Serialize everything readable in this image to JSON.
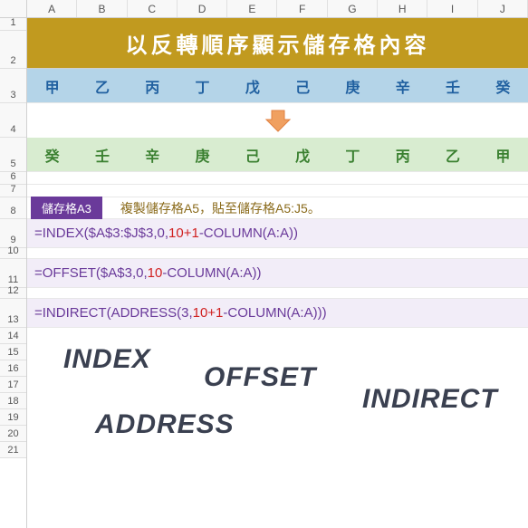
{
  "columns": [
    "A",
    "B",
    "C",
    "D",
    "E",
    "F",
    "G",
    "H",
    "I",
    "J"
  ],
  "rows": [
    "1",
    "2",
    "3",
    "4",
    "5",
    "6",
    "7",
    "8",
    "9",
    "10",
    "11",
    "12",
    "13",
    "14",
    "15",
    "16",
    "17",
    "18",
    "19",
    "20",
    "21"
  ],
  "title": "以反轉順序顯示儲存格內容",
  "rowBlue": [
    "甲",
    "乙",
    "丙",
    "丁",
    "戊",
    "己",
    "庚",
    "辛",
    "壬",
    "癸"
  ],
  "rowGreen": [
    "癸",
    "壬",
    "辛",
    "庚",
    "己",
    "戊",
    "丁",
    "丙",
    "乙",
    "甲"
  ],
  "cellLabel": "儲存格A3",
  "copyNote": "複製儲存格A5，貼至儲存格A5:J5。",
  "formula1": {
    "pre": "=INDEX($A$3:$J$3,0,",
    "red": "10+1",
    "post": "-COLUMN(A:A))"
  },
  "formula2": {
    "pre": "=OFFSET($A$3,0,",
    "red": "10",
    "post": "-COLUMN(A:A))"
  },
  "formula3": {
    "pre": "=INDIRECT(ADDRESS(3,",
    "red": "10+1",
    "post": "-COLUMN(A:A)))"
  },
  "bigWords": {
    "w1": "INDEX",
    "w2": "OFFSET",
    "w3": "INDIRECT",
    "w4": "ADDRESS"
  },
  "rowHeights": {
    "r1": 14,
    "r2": 42,
    "r3": 38,
    "r4": 38,
    "r5": 38,
    "r6": 14,
    "r7": 14,
    "r8": 24,
    "r9": 32,
    "r10": 12,
    "r11": 32,
    "r12": 12,
    "r13": 32,
    "r14": 18,
    "r15": 18,
    "r16": 18,
    "r17": 18,
    "r18": 18,
    "r19": 18,
    "r20": 18,
    "r21": 18
  }
}
